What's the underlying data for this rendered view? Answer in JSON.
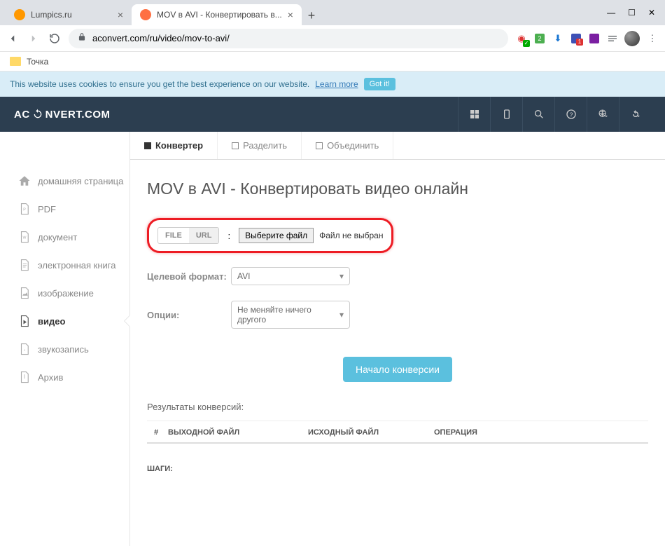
{
  "browser": {
    "tabs": [
      {
        "title": "Lumpics.ru",
        "favcolor": "#ff9800"
      },
      {
        "title": "MOV в AVI - Конвертировать в...",
        "favcolor": "#ff7043"
      }
    ],
    "url": "aconvert.com/ru/video/mov-to-avi/",
    "bookmark": "Точка"
  },
  "cookie": {
    "text": "This website uses cookies to ensure you get the best experience on our website.",
    "learn": "Learn more",
    "btn": "Got it!"
  },
  "logo": {
    "p1": "AC",
    "p2": "NVERT.COM"
  },
  "sidebar": [
    {
      "label": "домашняя страница",
      "icon": "home"
    },
    {
      "label": "PDF",
      "icon": "pdf"
    },
    {
      "label": "документ",
      "icon": "doc"
    },
    {
      "label": "электронная книга",
      "icon": "ebook"
    },
    {
      "label": "изображение",
      "icon": "image"
    },
    {
      "label": "видео",
      "icon": "video",
      "active": true
    },
    {
      "label": "звукозапись",
      "icon": "audio"
    },
    {
      "label": "Архив",
      "icon": "archive"
    }
  ],
  "ctabs": [
    {
      "label": "Конвертер",
      "active": true
    },
    {
      "label": "Разделить"
    },
    {
      "label": "Объединить"
    }
  ],
  "page": {
    "title": "MOV в AVI - Конвертировать видео онлайн",
    "file_tab": "FILE",
    "url_tab": "URL",
    "choose": "Выберите файл",
    "nofile": "Файл не выбран",
    "format_label": "Целевой формат:",
    "format_value": "AVI",
    "options_label": "Опции:",
    "options_value": "Не меняйте ничего другого",
    "start": "Начало конверсии",
    "results": "Результаты конверсий:",
    "col1": "#",
    "col2": "ВЫХОДНОЙ ФАЙЛ",
    "col3": "ИСХОДНЫЙ ФАЙЛ",
    "col4": "ОПЕРАЦИЯ",
    "steps": "ШАГИ:"
  }
}
